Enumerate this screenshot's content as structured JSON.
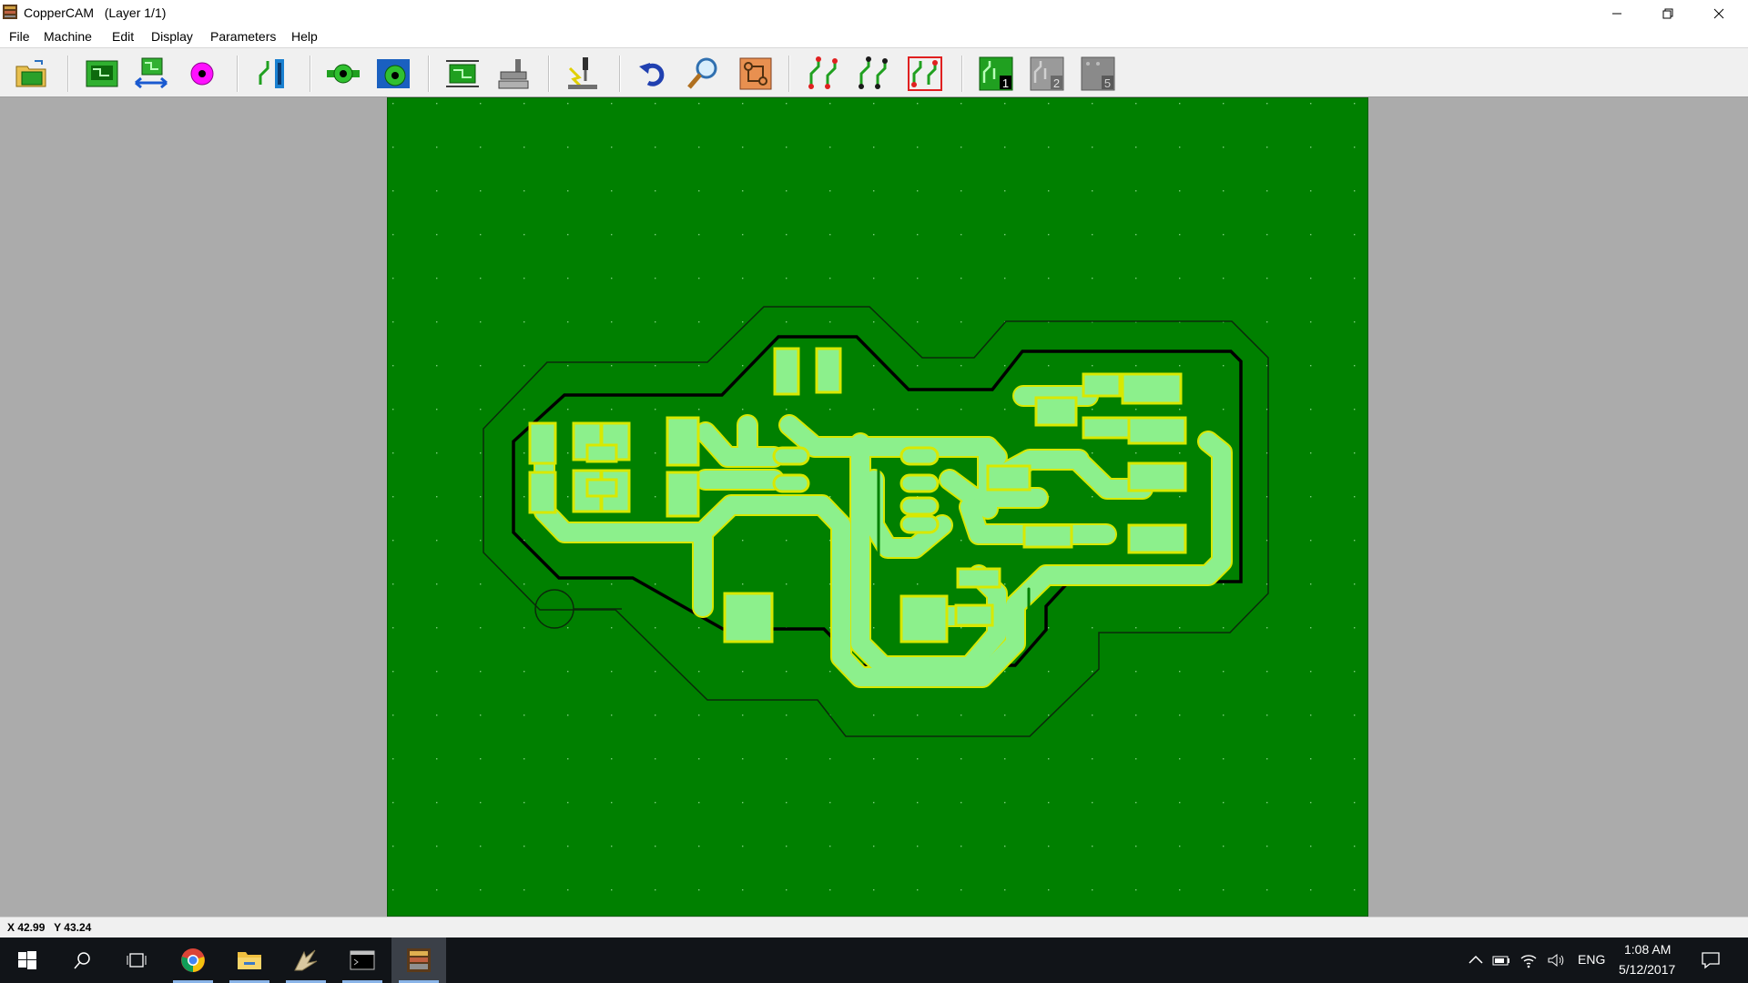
{
  "window": {
    "app_name": "CopperCAM",
    "title": "CopperCAM   (Layer 1/1)",
    "controls": [
      "minimize",
      "restore",
      "close"
    ]
  },
  "menu": {
    "items": [
      "File",
      "Machine",
      "Edit",
      "Display",
      "Parameters",
      "Help"
    ]
  },
  "toolbar": {
    "buttons": [
      {
        "name": "open-icon"
      },
      {
        "name": "new-board-icon"
      },
      {
        "name": "mirror-board-icon"
      },
      {
        "name": "pad-marker-icon"
      },
      {
        "name": "set-reference-icon"
      },
      {
        "name": "pad-icon"
      },
      {
        "name": "pad-drill-icon"
      },
      {
        "name": "board-dimensions-icon"
      },
      {
        "name": "tool-library-icon"
      },
      {
        "name": "mill-icon"
      },
      {
        "name": "undo-icon"
      },
      {
        "name": "zoom-icon"
      },
      {
        "name": "contour-icon"
      },
      {
        "name": "calculate-contours-icon"
      },
      {
        "name": "contour-options-icon"
      },
      {
        "name": "reset-contours-icon"
      },
      {
        "name": "layer-1-icon",
        "label": "1"
      },
      {
        "name": "layer-2-icon",
        "label": "2"
      },
      {
        "name": "layer-5-icon",
        "label": "5"
      }
    ]
  },
  "status": {
    "coordinates": "X 42.99   Y 43.24"
  },
  "taskbar": {
    "apps": [
      "start",
      "search",
      "task-view",
      "chrome",
      "file-explorer",
      "eagle",
      "command-prompt",
      "coppercam"
    ],
    "language": "ENG",
    "time": "1:08 AM",
    "date": "5/12/2017"
  },
  "colors": {
    "board_green": "#008000",
    "trace_light": "#8cf08c",
    "trace_outline": "#d8e800",
    "workspace_gray": "#ababab",
    "taskbar_bg": "#111418"
  }
}
